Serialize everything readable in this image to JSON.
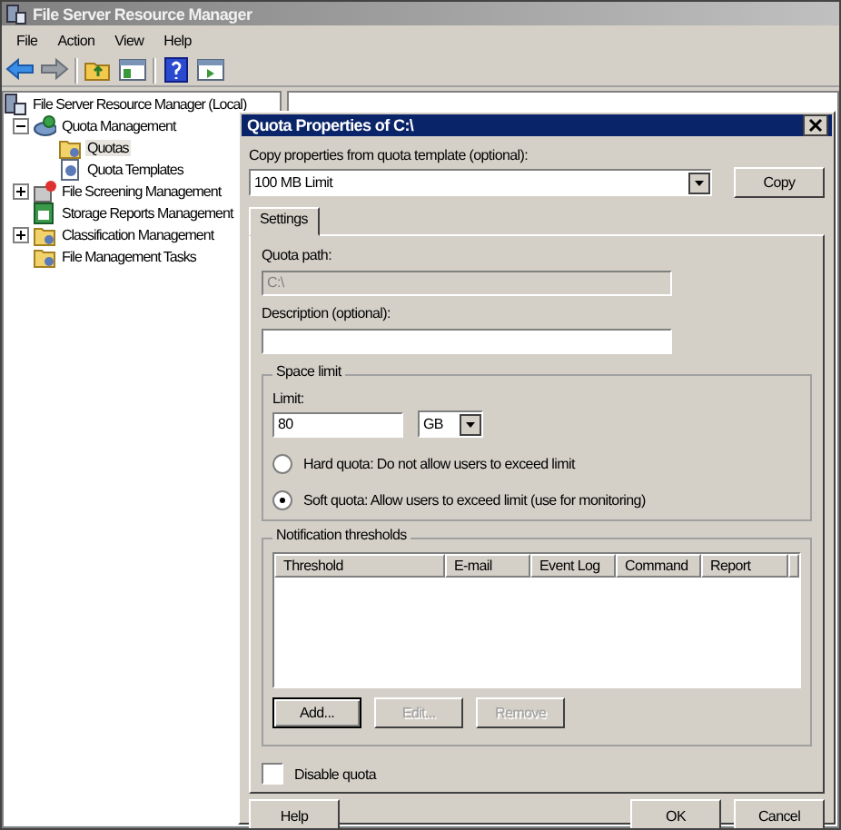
{
  "window": {
    "title": "File Server Resource Manager"
  },
  "menu": [
    {
      "label": "File"
    },
    {
      "label": "Action"
    },
    {
      "label": "View"
    },
    {
      "label": "Help"
    }
  ],
  "toolbar": [
    {
      "kind": "back"
    },
    {
      "kind": "forward"
    },
    {
      "kind": "sep"
    },
    {
      "kind": "folder-up"
    },
    {
      "kind": "pane"
    },
    {
      "kind": "sep"
    },
    {
      "kind": "help"
    },
    {
      "kind": "pane2"
    }
  ],
  "tree": [
    {
      "label": "File Server Resource Manager (Local)",
      "kind": "server",
      "selected": false,
      "children": [
        {
          "label": "Quota Management",
          "kind": "quota",
          "expanded": true,
          "selected": false,
          "children": [
            {
              "label": "Quotas",
              "kind": "folder",
              "selected": true
            },
            {
              "label": "Quota Templates",
              "kind": "template",
              "selected": false
            }
          ]
        },
        {
          "label": "File Screening Management",
          "kind": "screen",
          "expanded": false,
          "selected": false
        },
        {
          "label": "Storage Reports Management",
          "kind": "report",
          "selected": false
        },
        {
          "label": "Classification Management",
          "kind": "folder",
          "expanded": false,
          "selected": false
        },
        {
          "label": "File Management Tasks",
          "kind": "folder",
          "selected": false
        }
      ]
    }
  ],
  "dialog": {
    "title": "Quota Properties of C:\\",
    "template_label": "Copy properties from quota template (optional):",
    "template_value": "100 MB Limit",
    "copy_button": "Copy",
    "tabs": [
      {
        "label": "Settings",
        "selected": true
      }
    ],
    "quota_path": {
      "label": "Quota path:",
      "value": "C:\\",
      "disabled": true
    },
    "description": {
      "label": "Description (optional):"
    },
    "space_limit": {
      "title": "Space limit",
      "limit_label": "Limit:",
      "limit_value": "80",
      "unit": "GB",
      "options": [
        {
          "label": "Hard quota: Do not allow users to exceed limit",
          "selected": false
        },
        {
          "label": "Soft quota: Allow users to exceed limit (use for monitoring)",
          "selected": true
        }
      ]
    },
    "notifications": {
      "title": "Notification thresholds",
      "columns": [
        "Threshold",
        "E-mail",
        "Event Log",
        "Command",
        "Report"
      ],
      "buttons": [
        {
          "label": "Add...",
          "disabled": false
        },
        {
          "label": "Edit...",
          "disabled": true
        },
        {
          "label": "Remove",
          "disabled": true
        }
      ]
    },
    "disable_quota": {
      "label": "Disable quota",
      "checked": false
    },
    "footer": [
      {
        "label": "Help",
        "kind": "left"
      },
      {
        "label": "OK",
        "kind": "right"
      },
      {
        "label": "Cancel",
        "kind": "right"
      }
    ]
  }
}
